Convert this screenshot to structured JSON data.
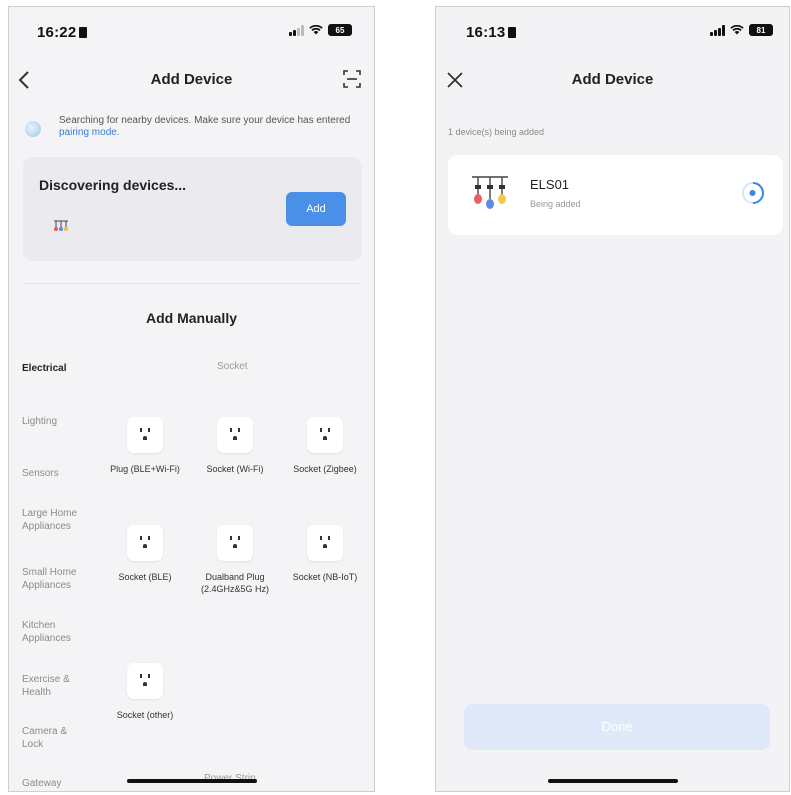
{
  "left_screen": {
    "status": {
      "time": "16:22",
      "battery": "65"
    },
    "nav": {
      "title": "Add Device",
      "back_icon": "chevron-left-icon",
      "scan_icon": "scan-icon"
    },
    "tip": {
      "text": "Searching for nearby devices. Make sure your device has entered ",
      "link": "pairing mode."
    },
    "discover": {
      "title": "Discovering devices...",
      "add_label": "Add"
    },
    "manual": {
      "title": "Add Manually"
    },
    "categories": [
      "Electrical",
      "Lighting",
      "Sensors",
      "Large Home Appliances",
      "Small Home Appliances",
      "Kitchen Appliances",
      "Exercise & Health",
      "Camera & Lock",
      "Gateway Control"
    ],
    "sections": {
      "socket": "Socket",
      "power_strip": "Power Strip"
    },
    "devices": [
      {
        "label": "Plug (BLE+Wi-Fi)"
      },
      {
        "label": "Socket (Wi-Fi)"
      },
      {
        "label": "Socket (Zigbee)"
      },
      {
        "label": "Socket (BLE)"
      },
      {
        "label": "Dualband Plug (2.4GHz&5G Hz)"
      },
      {
        "label": "Socket (NB-IoT)"
      },
      {
        "label": "Socket (other)"
      }
    ]
  },
  "right_screen": {
    "status": {
      "time": "16:13",
      "battery": "81"
    },
    "nav": {
      "title": "Add Device",
      "close_icon": "close-icon"
    },
    "count_text": "1 device(s) being added",
    "device": {
      "name": "ELS01",
      "status": "Being added"
    },
    "done_label": "Done"
  },
  "colors": {
    "accent": "#4a90e8",
    "done_disabled": "#dfe9fa",
    "card": "#ebebef"
  }
}
